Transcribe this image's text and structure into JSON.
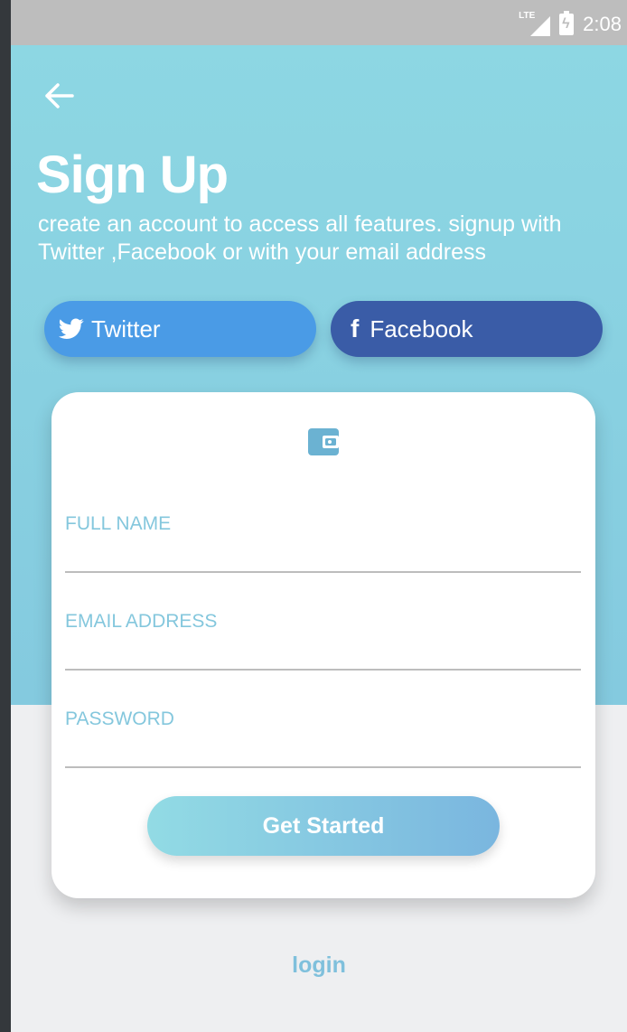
{
  "status_bar": {
    "network_label": "LTE",
    "time": "2:08",
    "icons": [
      "lte-signal-icon",
      "battery-charging-icon"
    ]
  },
  "header": {
    "back_icon": "arrow-left-icon",
    "title": "Sign Up",
    "subtitle": "create an account to access all features. signup with Twitter ,Facebook or with your email address"
  },
  "social": {
    "twitter_label": "Twitter",
    "facebook_label": "Facebook",
    "twitter_icon": "twitter-bird-icon",
    "facebook_icon": "facebook-f-icon"
  },
  "form": {
    "icon": "wallet-icon",
    "full_name": {
      "placeholder": "FULL NAME",
      "value": ""
    },
    "email": {
      "placeholder": "EMAIL ADDRESS",
      "value": ""
    },
    "password": {
      "placeholder": "PASSWORD",
      "value": ""
    },
    "submit_label": "Get Started"
  },
  "footer": {
    "login_label": "login"
  },
  "colors": {
    "hero_top": "#8dd7e3",
    "hero_bottom": "#84cadf",
    "twitter": "#4a9be6",
    "facebook": "#3a5ca7",
    "accent": "#84c7dd",
    "page_bg": "#eeeff1"
  }
}
